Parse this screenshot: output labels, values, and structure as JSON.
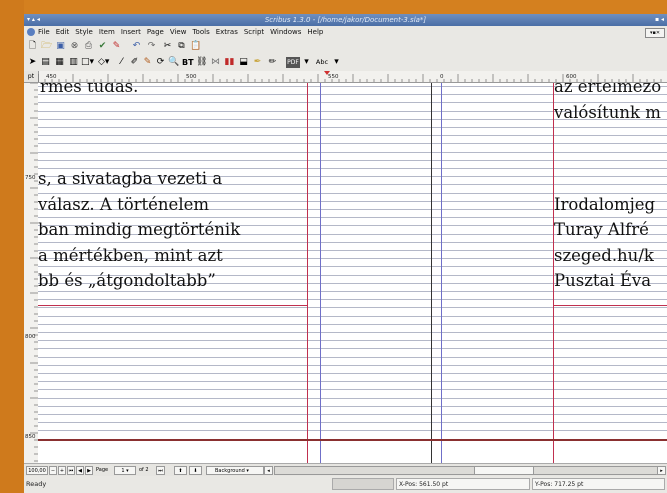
{
  "window": {
    "title": "Scribus 1.3.0 - [/home/jakor/Document-3.sla*]"
  },
  "menu": [
    "File",
    "Edit",
    "Style",
    "Item",
    "Insert",
    "Page",
    "View",
    "Tools",
    "Extras",
    "Script",
    "Windows",
    "Help"
  ],
  "ruler": {
    "corner": "pt",
    "htick_labels": [
      "450",
      "500",
      "550",
      "0",
      "600"
    ],
    "vtick_labels": [
      "750",
      "800",
      "850"
    ]
  },
  "toolbar": {
    "text_style_label": "Abc",
    "edit_btn": "ВТ"
  },
  "page_left_text": [
    "rmes tudás.",
    "s, a sivatagba vezeti a",
    "válasz.   A   történelem",
    "ban mindig megtörténik",
    "a mértékben, mint azt",
    "bb   és   „átgondoltabb”"
  ],
  "page_right_text": [
    "az értelmező",
    "valósítunk m",
    "Irodalomjeg",
    "Turay Alfré",
    "szeged.hu/k",
    "Pusztai Éva"
  ],
  "bottom_bar": {
    "zoom": "100,00 %",
    "page_label": "Page",
    "page_value": "1",
    "page_of": "of 2",
    "layer": "Background"
  },
  "status": {
    "state": "Ready",
    "xpos": "X-Pos: 561.50 pt",
    "ypos": "Y-Pos: 717.25 pt"
  },
  "colors": {
    "accent": "#d4801f",
    "titlebar": "#4a6ea6",
    "margin_guide": "#c0304f",
    "column_guide": "#6f6fc8",
    "baseline_grid": "#b4b8c8"
  }
}
